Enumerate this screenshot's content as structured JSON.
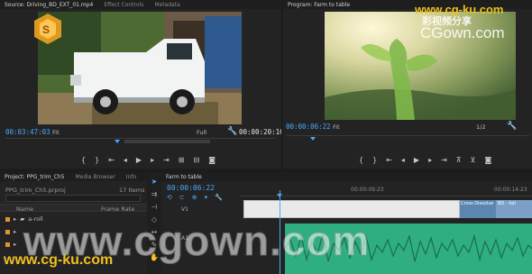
{
  "source": {
    "tabs": [
      "Source: Driving_BD_EXT_01.mp4",
      "Effect Controls",
      "Metadata"
    ],
    "timecode_in": "00:03:47:03",
    "timecode_duration": "00:00:20:16",
    "zoom": "Fit",
    "resolution": "Full"
  },
  "program": {
    "tab": "Program: Farm to table",
    "timecode": "00:00:06:22",
    "zoom": "Fit",
    "resolution": "1/2",
    "watermark_cn": "彩视频分享",
    "watermark_brand": "CGown.com"
  },
  "project": {
    "tabs": [
      "Project: PPG_trim_Ch5",
      "Media Browser",
      "Info"
    ],
    "file": "PPG_trim_Ch5.prproj",
    "item_count": "17 Items",
    "col_name": "Name",
    "col_rate": "Frame Rate",
    "bins": [
      "a-roll"
    ]
  },
  "timeline": {
    "tab": "Farm to table",
    "timecode": "00:00:06:22",
    "ruler_labels": [
      "00:00:09:23",
      "00:00:14:23"
    ],
    "tracks": [
      "V1",
      "A1"
    ],
    "transition_label": "Cross Dissolve",
    "clip_label": "BD - fall"
  },
  "watermark": {
    "url_small": "www.cg-ku.com",
    "url_large": "www.cgown.com",
    "url_bottom": "www.cg-ku.com"
  },
  "colors": {
    "accent": "#4aa8ff",
    "bin": "#e3912d",
    "audio": "#2fae80"
  }
}
